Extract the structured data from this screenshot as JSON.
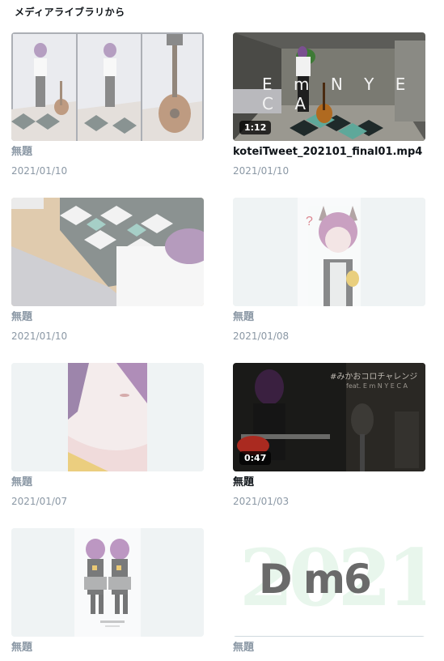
{
  "header": {
    "title": "メディアライブラリから"
  },
  "items": [
    {
      "title": "無題",
      "date": "2021/01/10",
      "duration": ""
    },
    {
      "title": "koteiTweet_202101_final01.mp4",
      "date": "2021/01/10",
      "duration": "1:12",
      "overlay_text": "E m N Y E C A"
    },
    {
      "title": "無題",
      "date": "2021/01/10",
      "duration": ""
    },
    {
      "title": "無題",
      "date": "2021/01/08",
      "duration": ""
    },
    {
      "title": "無題",
      "date": "2021/01/07",
      "duration": ""
    },
    {
      "title": "無題",
      "date": "2021/01/03",
      "duration": "0:47",
      "overlay_text": "#みかおコロチャレンジ",
      "overlay_sub": "feat. E m N Y E C A"
    },
    {
      "title": "無題",
      "date": "",
      "duration": ""
    },
    {
      "title": "無題",
      "date": "",
      "duration": "",
      "overlay_text": "D m6",
      "overlay_bg": "2021"
    }
  ],
  "colors": {
    "muted": "#8b98a5",
    "placeholder": "#eff3f4",
    "text": "#0f1419"
  }
}
